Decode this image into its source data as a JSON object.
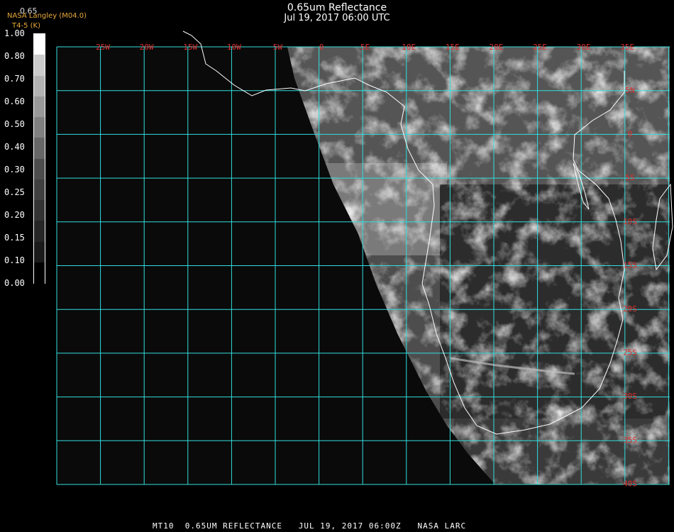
{
  "header": {
    "channel": "0.65",
    "credit": "NASA Langley (M04.0)",
    "unit": "T4-5 (K)",
    "title": "0.65um Reflectance",
    "datetime": "Jul 19, 2017 06:00 UTC"
  },
  "colorbar": {
    "labels": [
      "1.00",
      "0.80",
      "0.70",
      "0.60",
      "0.50",
      "0.40",
      "0.30",
      "0.25",
      "0.20",
      "0.15",
      "0.10",
      "0.00"
    ],
    "values": [
      1.0,
      0.8,
      0.7,
      0.6,
      0.5,
      0.4,
      0.3,
      0.25,
      0.2,
      0.15,
      0.1,
      0.0
    ]
  },
  "map": {
    "lon_labels": [
      "25W",
      "20W",
      "15W",
      "10W",
      "5W",
      "0",
      "5E",
      "10E",
      "15E",
      "20E",
      "25E",
      "30E",
      "35E"
    ],
    "lat_labels": [
      "5N",
      "0",
      "5S",
      "10S",
      "15S",
      "20S",
      "25S",
      "30S",
      "35S",
      "40S"
    ],
    "colors": {
      "grid": "#33dddd",
      "label": "#e03030",
      "coast": "#ffffff",
      "space": "#0a0a0a"
    }
  },
  "footer": {
    "text": "MT10  0.65UM REFLECTANCE   JUL 19, 2017 06:00Z   NASA LARC"
  }
}
